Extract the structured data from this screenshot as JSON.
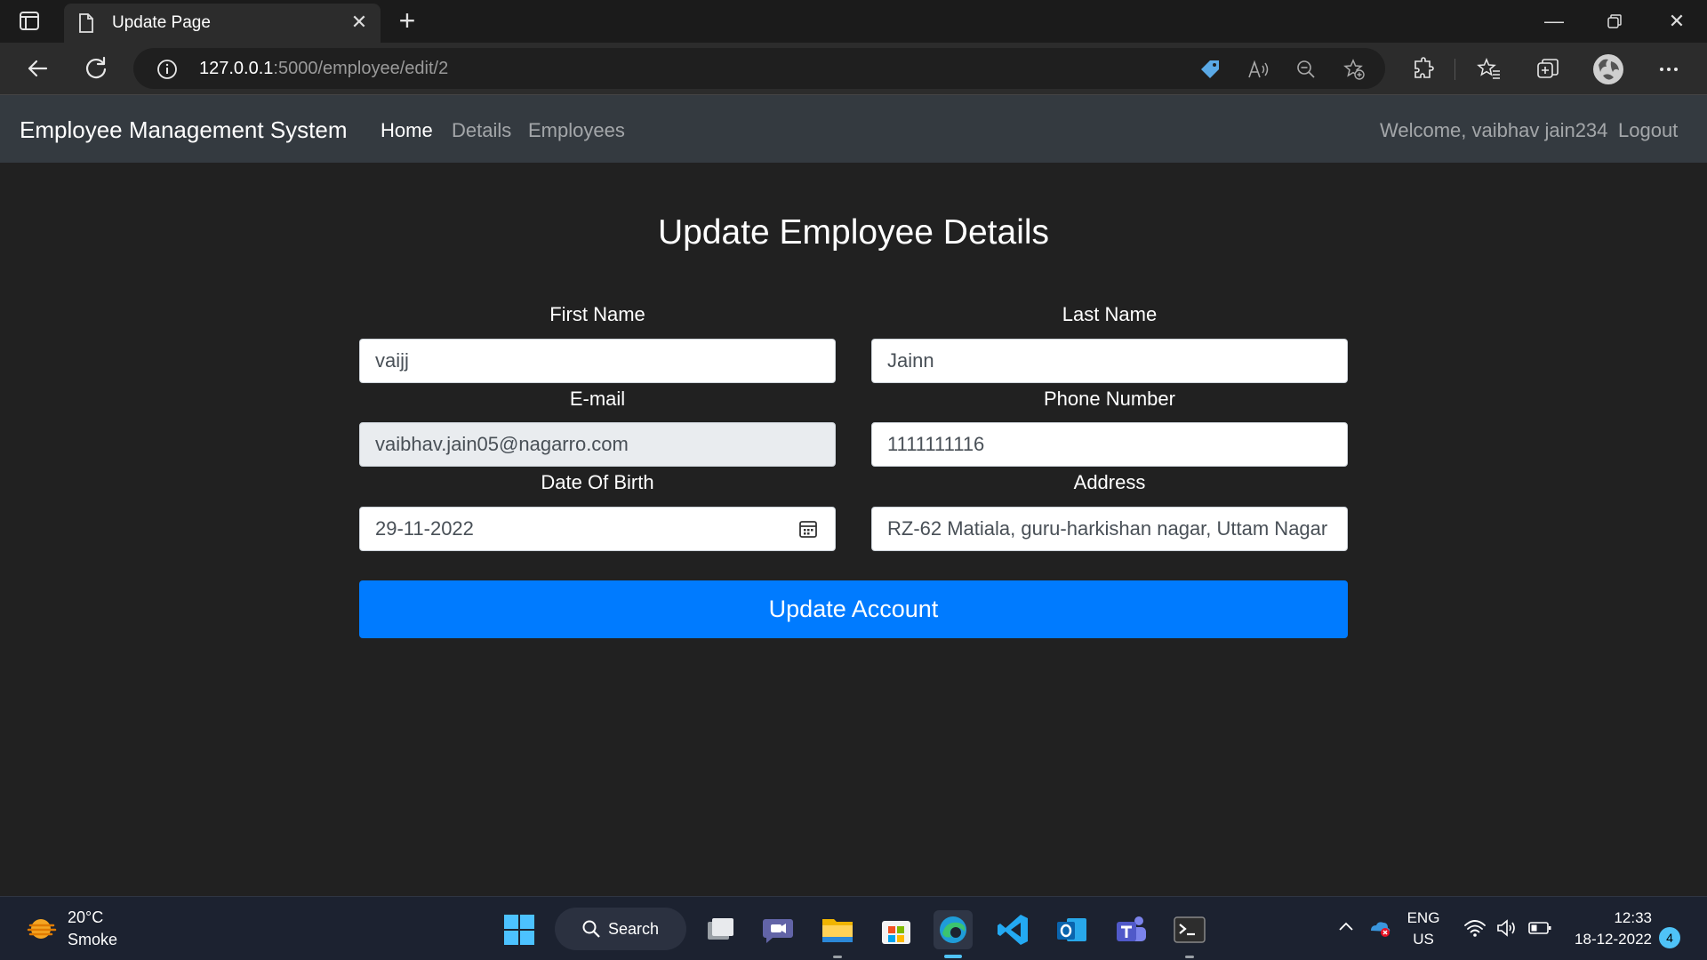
{
  "browser": {
    "tab_title": "Update Page",
    "url_host": "127.0.0.1",
    "url_path": ":5000/employee/edit/2"
  },
  "navbar": {
    "brand": "Employee Management System",
    "links": [
      "Home",
      "Details",
      "Employees"
    ],
    "welcome": "Welcome, vaibhav jain234",
    "logout": "Logout"
  },
  "form": {
    "title": "Update Employee Details",
    "first_name_label": "First Name",
    "first_name": "vaijj",
    "last_name_label": "Last Name",
    "last_name": "Jainn",
    "email_label": "E-mail",
    "email": "vaibhav.jain05@nagarro.com",
    "phone_label": "Phone Number",
    "phone": "1111111116",
    "dob_label": "Date Of Birth",
    "dob": "29-11-2022",
    "address_label": "Address",
    "address": "RZ-62 Matiala, guru-harkishan nagar, Uttam Nagar",
    "submit_label": "Update Account"
  },
  "taskbar": {
    "weather_temp": "20°C",
    "weather_desc": "Smoke",
    "search_label": "Search",
    "lang_top": "ENG",
    "lang_bottom": "US",
    "time": "12:33",
    "date": "18-12-2022",
    "notifications": "4"
  },
  "colors": {
    "page_bg": "#212121",
    "navbar_bg": "#343a40",
    "primary": "#007bff",
    "readonly_bg": "#e9ecef"
  }
}
